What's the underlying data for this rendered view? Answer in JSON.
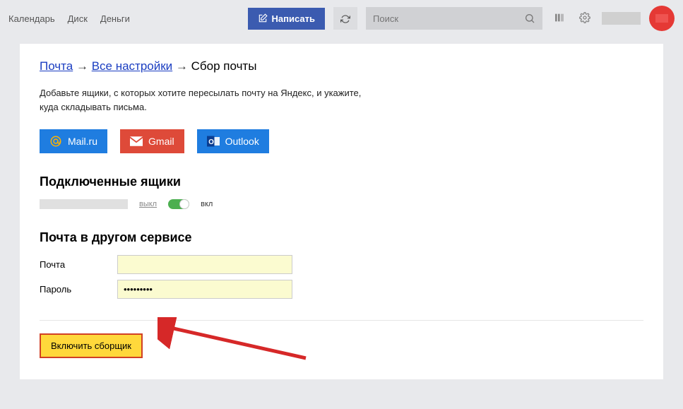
{
  "topbar": {
    "links": [
      "Календарь",
      "Диск",
      "Деньги"
    ],
    "compose_label": "Написать",
    "search_placeholder": "Поиск"
  },
  "breadcrumb": {
    "mail": "Почта",
    "all_settings": "Все настройки",
    "current": "Сбор почты"
  },
  "intro_text": "Добавьте ящики, с которых хотите пересылать почту на Яндекс, и укажите, куда складывать письма.",
  "providers": {
    "mailru": "Mail.ru",
    "gmail": "Gmail",
    "outlook": "Outlook"
  },
  "sections": {
    "connected_title": "Подключенные ящики",
    "other_service_title": "Почта в другом сервисе"
  },
  "toggle": {
    "off_label": "выкл",
    "on_label": "вкл"
  },
  "form": {
    "email_label": "Почта",
    "email_value": "",
    "password_label": "Пароль",
    "password_value": "•••••••••"
  },
  "submit_label": "Включить сборщик"
}
